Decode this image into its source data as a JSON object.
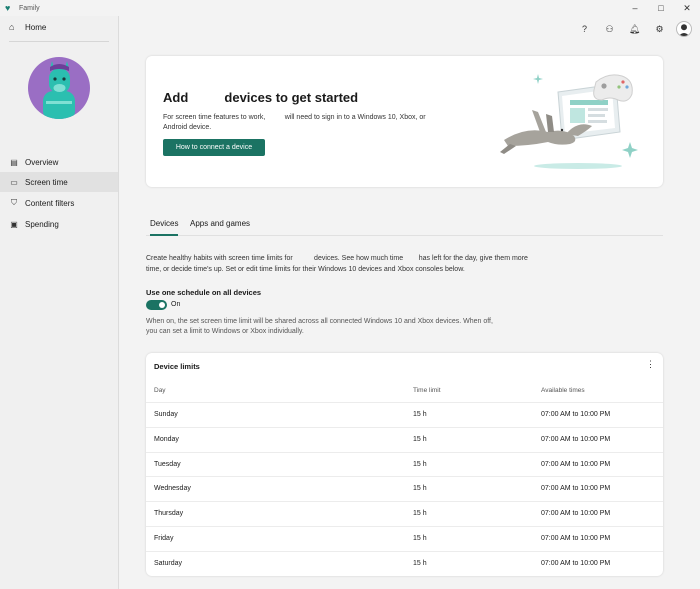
{
  "window": {
    "title": "Family",
    "controls": [
      "–",
      "□",
      "✕"
    ]
  },
  "sidebar": {
    "home_label": "Home",
    "items": [
      {
        "label": "Overview",
        "icon": "overview-icon",
        "active": false
      },
      {
        "label": "Screen time",
        "icon": "screen-time-icon",
        "active": true
      },
      {
        "label": "Content filters",
        "icon": "content-filters-icon",
        "active": false
      },
      {
        "label": "Spending",
        "icon": "spending-icon",
        "active": false
      }
    ]
  },
  "header_icons": [
    "help-icon",
    "family-icon",
    "notifications-icon",
    "settings-icon",
    "profile-avatar"
  ],
  "hero": {
    "title_prefix": "Add",
    "title_suffix": "devices to get started",
    "description": "For screen time features to work,          will need to sign in to a Windows 10, Xbox, or Android device.",
    "button_label": "How to connect a device"
  },
  "tabs": [
    {
      "label": "Devices",
      "active": true
    },
    {
      "label": "Apps and games",
      "active": false
    }
  ],
  "main": {
    "description": "Create healthy habits with screen time limits for           devices. See how much time        has left for the day, give them more time, or decide time's up. Set or edit time limits for their Windows 10 devices and Xbox consoles below.",
    "schedule_title": "Use one schedule on all devices",
    "toggle_label": "On",
    "schedule_note": "When on, the set screen time limit will be shared across all connected Windows 10 and Xbox devices. When off, you can set a limit to Windows or Xbox individually."
  },
  "device_limits": {
    "title": "Device limits",
    "columns": [
      "Day",
      "Time limit",
      "Available times"
    ],
    "rows": [
      {
        "day": "Sunday",
        "limit": "15 h",
        "available": "07:00 AM to 10:00 PM"
      },
      {
        "day": "Monday",
        "limit": "15 h",
        "available": "07:00 AM to 10:00 PM"
      },
      {
        "day": "Tuesday",
        "limit": "15 h",
        "available": "07:00 AM to 10:00 PM"
      },
      {
        "day": "Wednesday",
        "limit": "15 h",
        "available": "07:00 AM to 10:00 PM"
      },
      {
        "day": "Thursday",
        "limit": "15 h",
        "available": "07:00 AM to 10:00 PM"
      },
      {
        "day": "Friday",
        "limit": "15 h",
        "available": "07:00 AM to 10:00 PM"
      },
      {
        "day": "Saturday",
        "limit": "15 h",
        "available": "07:00 AM to 10:00 PM"
      }
    ]
  },
  "colors": {
    "accent": "#1b7363",
    "avatar_bg": "#9a6ec4",
    "llama": "#2bbfb0"
  }
}
